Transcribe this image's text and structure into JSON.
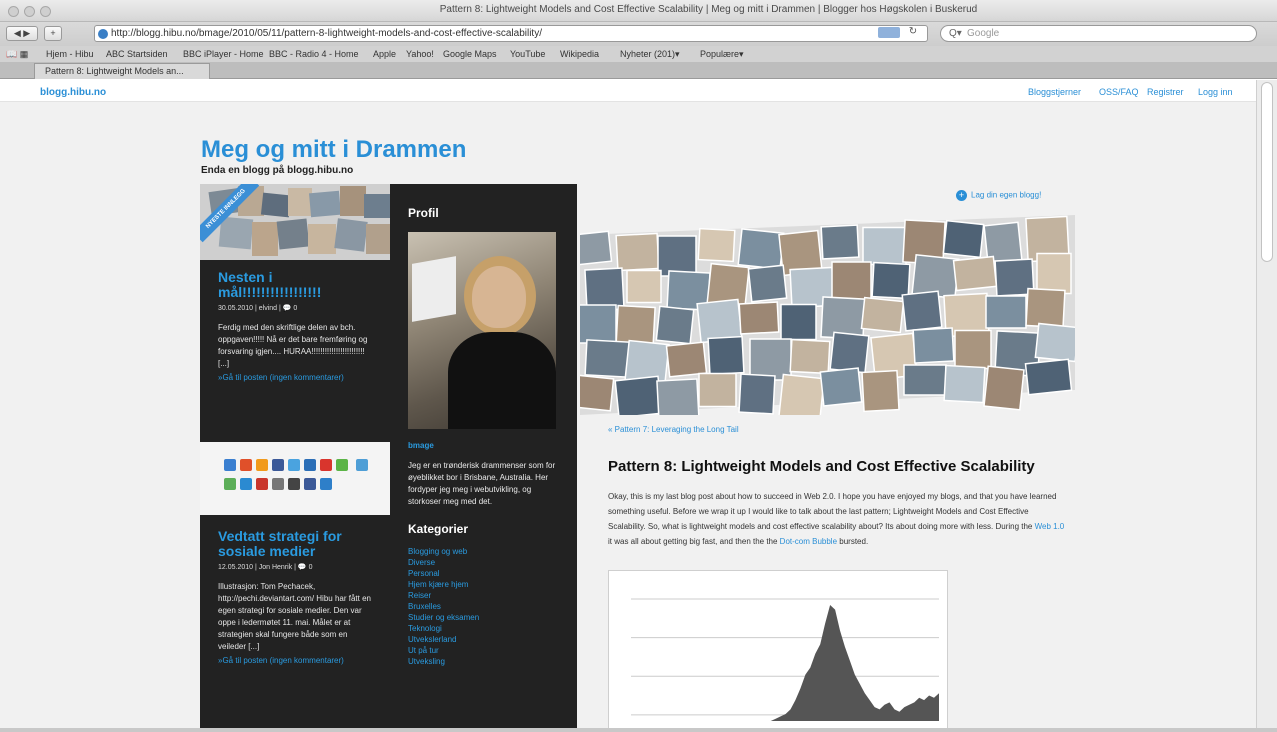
{
  "browser": {
    "window_title": "Pattern 8: Lightweight Models and Cost Effective Scalability | Meg og mitt i Drammen | Blogger hos Høgskolen i Buskerud",
    "url": "http://blogg.hibu.no/bmage/2010/05/11/pattern-8-lightweight-models-and-cost-effective-scalability/",
    "search_placeholder": "Google",
    "bookmarks": [
      "Hjem - Hibu",
      "ABC Startsiden",
      "BBC iPlayer - Home",
      "BBC - Radio 4 - Home",
      "Apple",
      "Yahoo!",
      "Google Maps",
      "YouTube",
      "Wikipedia",
      "Nyheter (201)▾",
      "Populære▾"
    ],
    "tab_label": "Pattern 8: Lightweight Models an..."
  },
  "topbar": {
    "site_link": "blogg.hibu.no",
    "links": [
      "Bloggstjerner",
      "OSS/FAQ",
      "Registrer",
      "Logg inn"
    ]
  },
  "blog": {
    "title": "Meg og mitt i Drammen",
    "subtitle": "Enda en blogg på blogg.hibu.no"
  },
  "sidebar1": {
    "ribbon": "NYESTE INNLEGG",
    "post1": {
      "title": "Nesten i mål!!!!!!!!!!!!!!!!!",
      "meta": "30.05.2010 | elvind | 💬 0",
      "body": "Ferdig med den skriftlige delen av bch. oppgaven!!!!! Nå er det bare fremføring og forsvaring igjen.... HURAA!!!!!!!!!!!!!!!!!!!!!!!! [...]",
      "more": "»Gå til posten (ingen kommentarer)"
    },
    "post2": {
      "title": "Vedtatt strategi for sosiale medier",
      "meta": "12.05.2010 | Jon Henrik | 💬 0",
      "body": "Illustrasjon: Tom Pechacek, http://pechi.deviantart.com/ Hibu har fått en egen strategi for sosiale medier. Den var oppe i ledermøtet 11. mai. Målet er at strategien skal fungere både som en veileder [...]",
      "more": "»Gå til posten (ingen kommentarer)"
    }
  },
  "sidebar2": {
    "profile_heading": "Profil",
    "profile_name": "bmage",
    "profile_text": "Jeg er en trønderisk drammenser som for øyeblikket bor i Brisbane, Australia. Her fordyper jeg meg i webutvikling, og storkoser meg med det.",
    "categories_heading": "Kategorier",
    "categories": [
      "Blogging og web",
      "Diverse",
      "Personal",
      "Hjem kjære hjem",
      "Reiser",
      "Bruxelles",
      "Studier og eksamen",
      "Teknologi",
      "Utvekslerland",
      "Ut på tur",
      "Utveksling"
    ]
  },
  "main": {
    "own_blog_link": "Lag din egen blogg!",
    "prev_link": "« Pattern 7: Leveraging the Long Tail",
    "post_title": "Pattern 8: Lightweight Models and Cost Effective Scalability",
    "body_parts": {
      "p1": "Okay, this is my last blog post about how to succeed in Web 2.0. I hope you have enjoyed my blogs, and that you have learned something useful. Before we wrap it up I would like to talk about the last pattern; Lightweight Models and Cost Effective Scalability. So, what is lightweight models and cost effective scalability about? Its about doing more with less. During the ",
      "link1": "Web 1.0",
      "p2": " it was all about getting big fast, and then the the ",
      "link2": "Dot-com Bubble",
      "p3": " bursted."
    }
  },
  "chart_data": {
    "type": "area",
    "x": [
      0,
      1,
      2,
      3,
      4,
      5,
      6,
      7,
      8,
      9,
      10,
      11,
      12,
      13,
      14,
      15,
      16,
      17,
      18,
      19,
      20,
      21,
      22,
      23,
      24,
      25,
      26,
      27,
      28,
      29,
      30,
      31,
      32,
      33,
      34,
      35,
      36,
      37,
      38,
      39,
      40
    ],
    "values": [
      0,
      0,
      0,
      0,
      0,
      0,
      0,
      2,
      4,
      6,
      10,
      18,
      28,
      40,
      46,
      58,
      66,
      84,
      100,
      96,
      78,
      64,
      52,
      40,
      32,
      24,
      18,
      12,
      10,
      14,
      16,
      10,
      8,
      12,
      14,
      16,
      20,
      18,
      22,
      20,
      24
    ],
    "title": "",
    "xlabel": "",
    "ylabel": "",
    "ylim": [
      0,
      100
    ],
    "yticks": [
      "",
      "",
      "",
      ""
    ],
    "color": "#555555"
  }
}
